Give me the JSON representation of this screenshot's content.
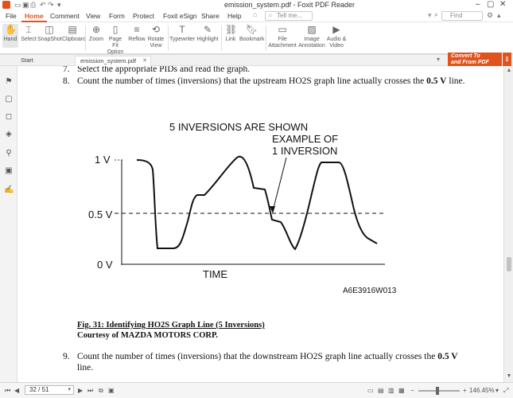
{
  "window": {
    "title": "emission_system.pdf - Foxit PDF Reader"
  },
  "menu": {
    "items": [
      "File",
      "Home",
      "Comment",
      "View",
      "Form",
      "Protect",
      "Foxit eSign",
      "Share",
      "Help"
    ],
    "active": "Home",
    "tell_me_placeholder": "Tell me...",
    "find_placeholder": "Find"
  },
  "ribbon": {
    "tools": [
      {
        "label": "Hand",
        "icon": "hand-icon"
      },
      {
        "label": "Select",
        "icon": "cursor-icon"
      },
      {
        "label": "SnapShot",
        "icon": "camera-icon"
      },
      {
        "label": "Clipboard",
        "icon": "clipboard-icon"
      },
      {
        "label": "Zoom",
        "icon": "zoom-icon"
      },
      {
        "label": "Page Fit Option",
        "icon": "page-fit-icon"
      },
      {
        "label": "Reflow",
        "icon": "reflow-icon"
      },
      {
        "label": "Rotate View",
        "icon": "rotate-icon"
      },
      {
        "label": "Typewriter",
        "icon": "typewriter-icon"
      },
      {
        "label": "Highlight",
        "icon": "highlighter-icon"
      },
      {
        "label": "Link",
        "icon": "link-icon"
      },
      {
        "label": "Bookmark",
        "icon": "bookmark-icon"
      },
      {
        "label": "File Attachment",
        "icon": "file-attachment-icon"
      },
      {
        "label": "Image Annotation",
        "icon": "image-icon"
      },
      {
        "label": "Audio & Video",
        "icon": "audio-video-icon"
      }
    ]
  },
  "tabs": {
    "start": "Start",
    "document": "emission_system.pdf"
  },
  "convert": {
    "line1": "Convert To",
    "line2": "and From PDF"
  },
  "document": {
    "step7_num": "7.",
    "step7_text": "Select the appropriate PIDs and read the graph.",
    "step8_num": "8.",
    "step8_text_a": "Count the number of times (inversions) that the upstream HO2S graph line actually crosses the ",
    "step8_text_b": "0.5 V",
    "step8_text_c": " line.",
    "figure": {
      "headline": "5 INVERSIONS ARE SHOWN",
      "example_line1": "EXAMPLE OF",
      "example_line2": "1 INVERSION",
      "label_1v": "1 V",
      "label_05v": "0.5 V",
      "label_0v": "0 V",
      "axis_time": "TIME",
      "code": "A6E3916W013"
    },
    "caption_title": "Fig. 31: Identifying HO2S Graph Line (5 Inversions)",
    "caption_credit": "Courtesy of MAZDA MOTORS CORP.",
    "step9_num": "9.",
    "step9_text_a": "Count the number of times (inversions) that the downstream HO2S graph line actually crosses the ",
    "step9_text_b": "0.5 V",
    "step9_text_c": "line."
  },
  "status": {
    "page_indicator": "32 / 51",
    "zoom": "146.45%"
  },
  "colors": {
    "accent": "#e0531c"
  }
}
